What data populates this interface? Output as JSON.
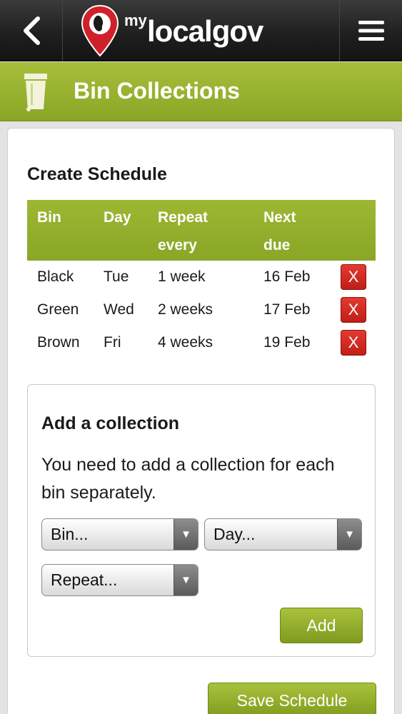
{
  "nav": {
    "back_icon": "chevron-left-icon",
    "menu_icon": "hamburger-icon",
    "logo": {
      "prefix": "my",
      "name": "localgov",
      "pin_color": "#d0202a"
    }
  },
  "header": {
    "title": "Bin Collections",
    "icon": "bin-icon"
  },
  "schedule": {
    "title": "Create Schedule",
    "columns": {
      "bin": "Bin",
      "day": "Day",
      "repeat_line1": "Repeat",
      "repeat_line2": "every",
      "next_line1": "Next",
      "next_line2": "due"
    },
    "rows": [
      {
        "bin": "Black",
        "day": "Tue",
        "repeat": "1 week",
        "next": "16 Feb",
        "delete": "X"
      },
      {
        "bin": "Green",
        "day": "Wed",
        "repeat": "2 weeks",
        "next": "17 Feb",
        "delete": "X"
      },
      {
        "bin": "Brown",
        "day": "Fri",
        "repeat": "4 weeks",
        "next": "19 Feb",
        "delete": "X"
      }
    ]
  },
  "add_collection": {
    "title": "Add a collection",
    "hint": "You need to add a collection for each bin separately.",
    "bin_select": "Bin...",
    "day_select": "Day...",
    "repeat_select": "Repeat...",
    "add_label": "Add"
  },
  "save_label": "Save Schedule",
  "colors": {
    "accent": "#8aa626",
    "delete": "#c9221c",
    "topbar": "#1e1e1e"
  }
}
